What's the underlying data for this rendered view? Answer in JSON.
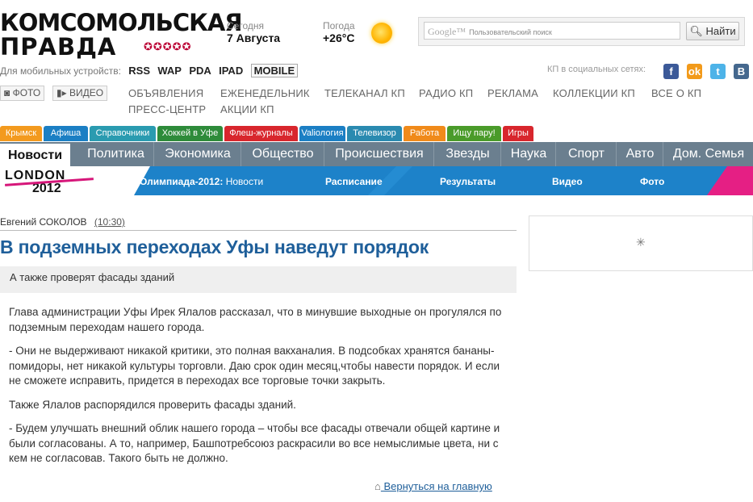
{
  "header": {
    "logo_line1": "КОМСОМОЛЬСКАЯ",
    "logo_line2": "ПРАВДА",
    "today_label": "Сегодня",
    "today_value": "7 Августа",
    "weather_label": "Погода",
    "weather_value": "+26°C",
    "search_placeholder": "Пользовательский поиск",
    "search_google": "Google™",
    "search_button": "Найти"
  },
  "mobile": {
    "label": "Для мобильных устройств:",
    "links": [
      "RSS",
      "WAP",
      "PDA",
      "IPAD",
      "MOBILE"
    ],
    "social_label": "КП в социальных сетях:"
  },
  "sections": {
    "photo": "ФОТО",
    "video": "ВИДЕО",
    "links": [
      "ОБЪЯВЛЕНИЯ",
      "ЕЖЕНЕДЕЛЬНИК",
      "ТЕЛЕКАНАЛ КП",
      "РАДИО КП",
      "РЕКЛАМА",
      "КОЛЛЕКЦИИ КП",
      "ВСЕ О КП",
      "ПРЕСС-ЦЕНТР",
      "АКЦИИ КП"
    ]
  },
  "color_tabs": [
    {
      "label": "Крымск",
      "color": "#f39a1e"
    },
    {
      "label": "Афиша",
      "color": "#1b7fc4"
    },
    {
      "label": "Справочники",
      "color": "#2a9bb0"
    },
    {
      "label": "Хоккей в Уфе",
      "color": "#2e8b3a"
    },
    {
      "label": "Флеш-журналы",
      "color": "#d8262d"
    },
    {
      "label": "Valiология",
      "color": "#1b7fc4"
    },
    {
      "label": "Телевизор",
      "color": "#2a8ab0"
    },
    {
      "label": "Работа",
      "color": "#f08a1a"
    },
    {
      "label": "Ищу пару!",
      "color": "#4a9b2a"
    },
    {
      "label": "Игры",
      "color": "#d8262d"
    }
  ],
  "nav": {
    "active": "Новости",
    "items": [
      "Политика",
      "Экономика",
      "Общество",
      "Происшествия",
      "Звезды",
      "Наука",
      "Спорт",
      "Авто",
      "Дом. Семья"
    ]
  },
  "olympics": {
    "logo_line1": "LONDON",
    "logo_line2": "2012",
    "title": "Олимпиада-2012:",
    "news": "Новости",
    "items": [
      "Расписание",
      "Результаты",
      "Видео",
      "Фото"
    ]
  },
  "article": {
    "author": "Евгений СОКОЛОВ",
    "time": "(10:30)",
    "title": "В подземных переходах Уфы наведут порядок",
    "lead": "А также проверят фасады зданий",
    "paragraphs": [
      "Глава администрации Уфы Ирек Ялалов рассказал, что в минувшие выходные он прогулялся по подземным переходам нашего города.",
      "- Они не выдерживают никакой критики, это полная вакханалия. В подсобках хранятся бананы-помидоры, нет никакой культуры торговли. Даю срок один месяц,чтобы навести порядок. И если не сможете исправить, придется в переходах все торговые точки закрыть.",
      "Также Ялалов распорядился проверить фасады зданий.",
      "- Будем улучшать внешний облик нашего города – чтобы все фасады отвечали общей картине и были согласованы. А то, например, Башпотребсоюз раскрасили во все немыслимые цвета, ни с кем не согласовав. Такого быть не должно."
    ],
    "back_link": "Вернуться на главную"
  }
}
